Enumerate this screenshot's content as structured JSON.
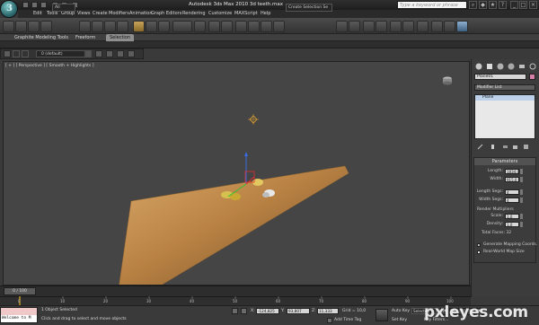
{
  "titlebar": {
    "title": "Autodesk 3ds Max  2010      3d teeth.max",
    "search_placeholder": "Type a keyword or phrase"
  },
  "menu": {
    "items": [
      "Edit",
      "Tools",
      "Group",
      "Views",
      "Create",
      "Modifiers",
      "Animation",
      "Graph Editors",
      "Rendering",
      "Customize",
      "MAXScript",
      "Help"
    ]
  },
  "toolbar": {
    "selection_filter": "All",
    "named_selection_set": "Create Selection Se"
  },
  "ribbon": {
    "tabs": [
      "Graphite Modeling Tools",
      "Freeform",
      "Selection"
    ],
    "active_tab": "Selection"
  },
  "layer": {
    "name": "0 (default)"
  },
  "viewport": {
    "label": "[ + ] [ Perspective ] [ Smooth + Highlights ]"
  },
  "command_panel": {
    "object_name": "Plane01",
    "object_color": "#d67fa8",
    "modifier_list": "Modifier List",
    "stack": [
      "Plane"
    ],
    "rollout_title": "Parameters",
    "params": [
      {
        "label": "Length:",
        "value": "1834,0"
      },
      {
        "label": "Width:",
        "value": "915,0"
      },
      {
        "label": "Length Segs:",
        "value": "4"
      },
      {
        "label": "Width Segs:",
        "value": "4"
      }
    ],
    "render_multipliers": "Render Multipliers",
    "scale": {
      "label": "Scale:",
      "value": "1,0"
    },
    "density": {
      "label": "Density:",
      "value": "1,0"
    },
    "total_faces": "Total Faces: 32",
    "checkbox1": "Generate Mapping Coords.",
    "checkbox2": "Real-World Map Size"
  },
  "timeline": {
    "slider_label": "0 / 100",
    "ticks": [
      "0",
      "10",
      "20",
      "30",
      "40",
      "50",
      "60",
      "70",
      "80",
      "90",
      "100"
    ]
  },
  "status": {
    "listener": "Welcome to M",
    "selected": "1 Object Selected",
    "prompt": "Click and drag to select and move objects",
    "x_label": "X:",
    "x_value": "-124,825",
    "y_label": "Y:",
    "y_value": "93,807",
    "z_label": "Z:",
    "z_value": "11,333",
    "grid": "Grid = 10,0",
    "add_time_tag": "Add Time Tag",
    "auto_key": "Auto Key",
    "selected_dd": "Selected",
    "set_key": "Set Key",
    "key_filters": "Key Filters..."
  },
  "watermark": "pxleyes.com"
}
